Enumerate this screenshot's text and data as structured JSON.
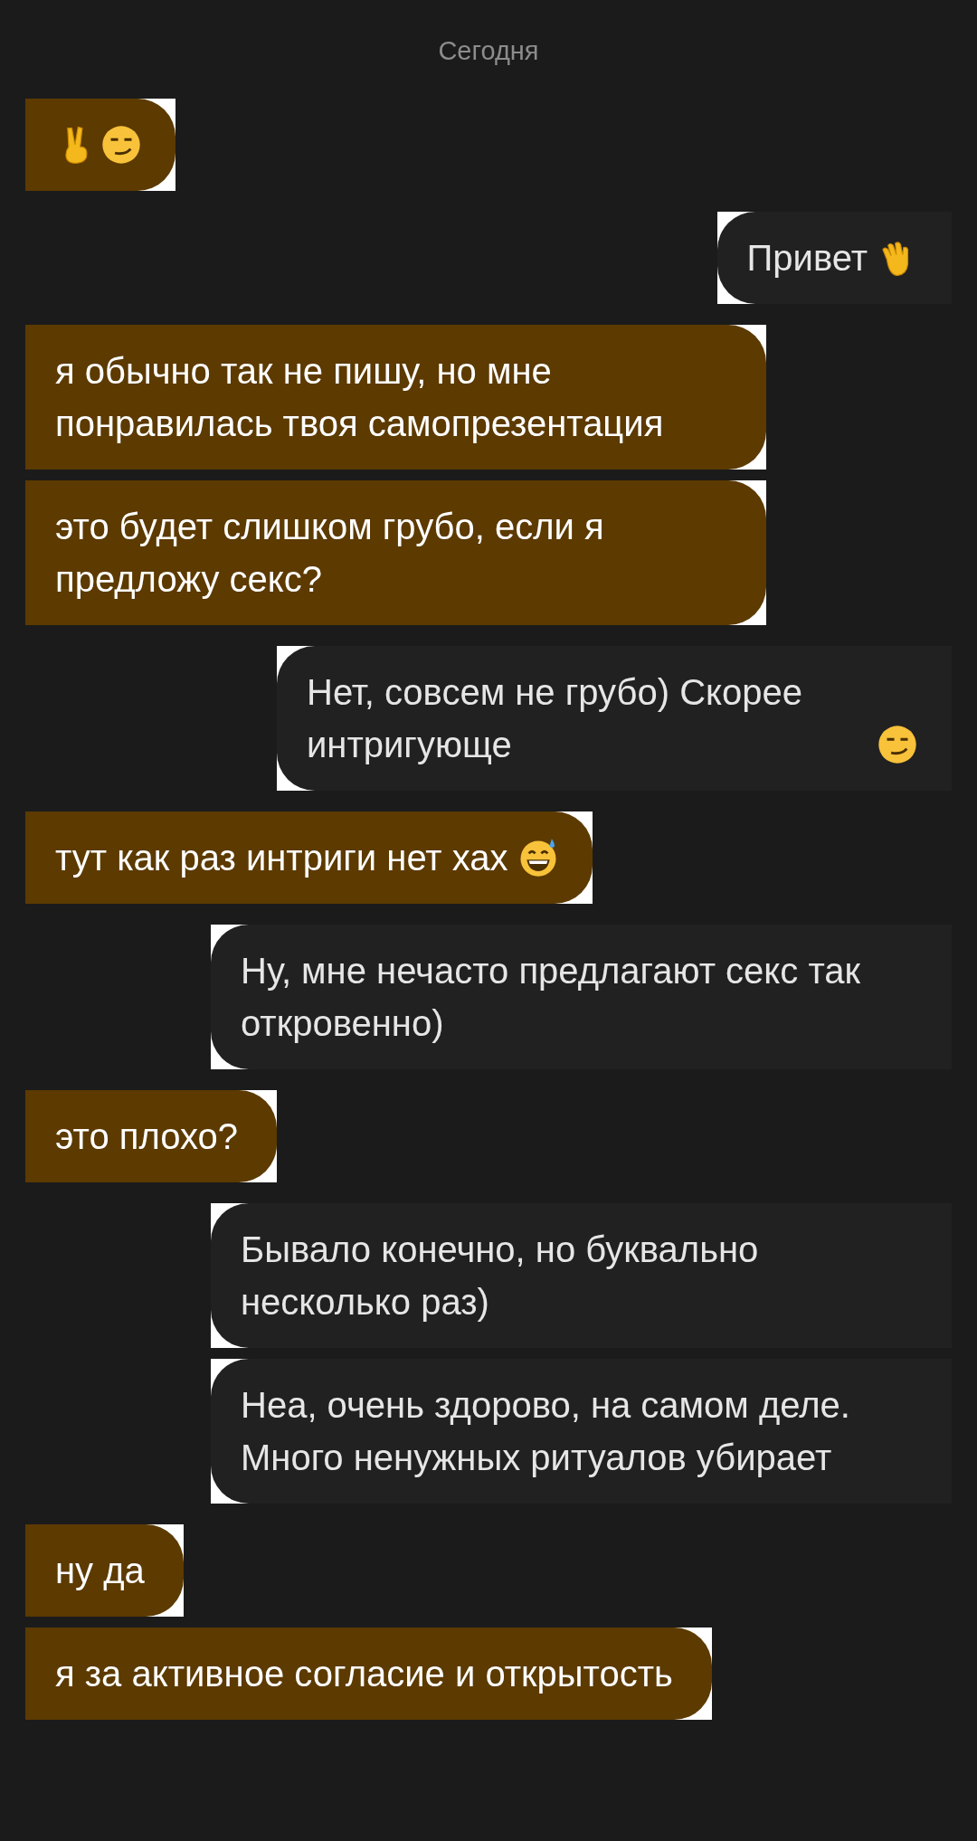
{
  "date_divider": "Сегодня",
  "messages": [
    {
      "kind": "incoming",
      "emoji": [
        {
          "kind": "victory"
        },
        {
          "kind": "smirk"
        }
      ]
    },
    {
      "kind": "outgoing",
      "text": "Привет",
      "emoji": [
        {
          "kind": "wave"
        }
      ]
    },
    {
      "kind": "incoming",
      "text": "я обычно так не пишу, но мне понравилась твоя самопрезентация"
    },
    {
      "kind": "incoming",
      "text": "это будет слишком грубо, если я предложу секс?"
    },
    {
      "kind": "outgoing",
      "text": "Нет, совсем не грубо) Скорее интригующе",
      "emoji": [
        {
          "kind": "smirk"
        }
      ]
    },
    {
      "kind": "incoming",
      "text": "тут как раз интриги нет хах",
      "emoji": [
        {
          "kind": "sweat-grin"
        }
      ]
    },
    {
      "kind": "outgoing",
      "text": "Ну, мне нечасто предлагают секс так откровенно)"
    },
    {
      "kind": "incoming",
      "text": "это плохо?"
    },
    {
      "kind": "outgoing",
      "text": "Бывало конечно, но буквально несколько раз)"
    },
    {
      "kind": "outgoing",
      "text": "Неа, очень здорово, на самом деле. Много ненужных ритуалов убирает"
    },
    {
      "kind": "incoming",
      "text": "ну да"
    },
    {
      "kind": "incoming",
      "text": "я за активное согласие и открытость"
    }
  ]
}
